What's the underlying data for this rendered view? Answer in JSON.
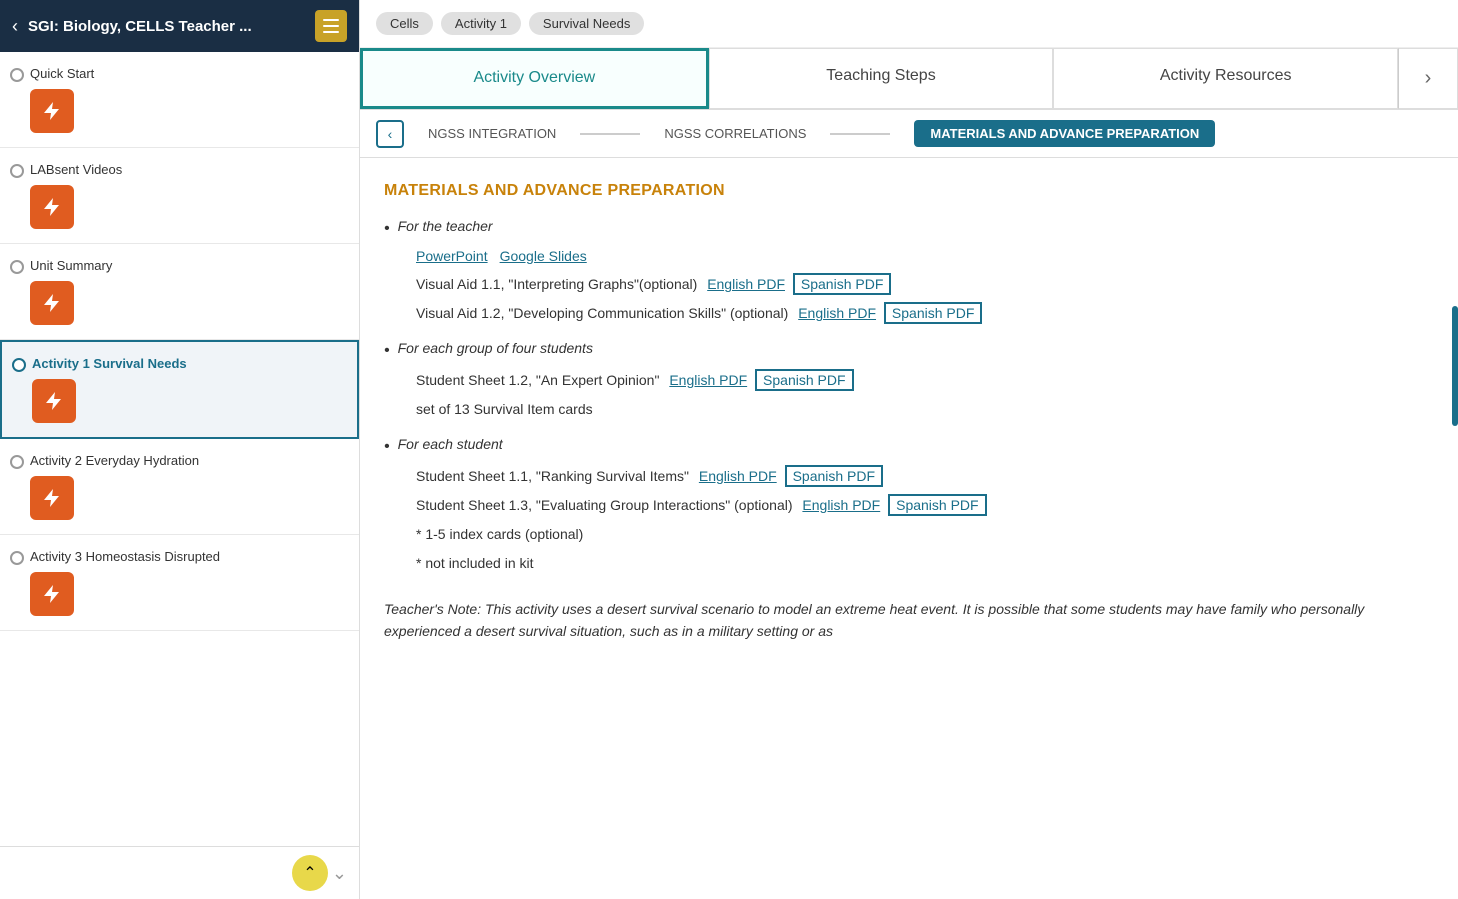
{
  "sidebar": {
    "header": {
      "title": "SGI: Biology, CELLS Teacher ...",
      "back_label": "‹",
      "menu_icon": "menu"
    },
    "items": [
      {
        "id": "quick-start",
        "label": "Quick Start",
        "active": false
      },
      {
        "id": "labsent-videos",
        "label": "LABsent Videos",
        "active": false
      },
      {
        "id": "unit-summary",
        "label": "Unit Summary",
        "active": false
      },
      {
        "id": "activity-1",
        "label": "Activity 1 Survival Needs",
        "active": true
      },
      {
        "id": "activity-2",
        "label": "Activity 2 Everyday Hydration",
        "active": false
      },
      {
        "id": "activity-3",
        "label": "Activity 3 Homeostasis Disrupted",
        "active": false
      }
    ],
    "scroll_up_label": "^"
  },
  "breadcrumb": {
    "items": [
      "Cells",
      "Activity 1",
      "Survival Needs"
    ]
  },
  "tabs": [
    {
      "id": "overview",
      "label": "Activity Overview",
      "active": true
    },
    {
      "id": "teaching",
      "label": "Teaching Steps",
      "active": false
    },
    {
      "id": "resources",
      "label": "Activity Resources",
      "active": false
    }
  ],
  "sub_nav": {
    "items": [
      {
        "id": "ngss-integration",
        "label": "NGSS INTEGRATION",
        "active": false
      },
      {
        "id": "ngss-correlations",
        "label": "NGSS CORRELATIONS",
        "active": false
      },
      {
        "id": "materials",
        "label": "MATERIALS AND ADVANCE PREPARATION",
        "active": true
      }
    ]
  },
  "content": {
    "title": "MATERIALS AND ADVANCE PREPARATION",
    "sections": [
      {
        "id": "for-teacher",
        "label": "For the teacher",
        "links_row": [
          {
            "text": "PowerPoint",
            "boxed": false
          },
          {
            "text": "Google Slides",
            "boxed": false
          }
        ],
        "items": [
          {
            "text": "Visual Aid 1.1, \"Interpreting Graphs\"(optional)",
            "links": [
              {
                "text": "English PDF",
                "boxed": false
              },
              {
                "text": "Spanish PDF",
                "boxed": true
              }
            ]
          },
          {
            "text": "Visual Aid 1.2, \"Developing Communication Skills\" (optional)",
            "links": [
              {
                "text": "English PDF",
                "boxed": false
              },
              {
                "text": "Spanish PDF",
                "boxed": true
              }
            ]
          }
        ]
      },
      {
        "id": "for-group",
        "label": "For each group of four students",
        "links_row": [],
        "items": [
          {
            "text": "Student Sheet 1.2, \"An Expert Opinion\"",
            "links": [
              {
                "text": "English PDF",
                "boxed": false
              },
              {
                "text": "Spanish PDF",
                "boxed": true
              }
            ]
          },
          {
            "text": "set of 13 Survival Item cards",
            "links": []
          }
        ]
      },
      {
        "id": "for-student",
        "label": "For each student",
        "links_row": [],
        "items": [
          {
            "text": "Student Sheet 1.1, \"Ranking Survival Items\"",
            "links": [
              {
                "text": "English PDF",
                "boxed": false
              },
              {
                "text": "Spanish PDF",
                "boxed": true
              }
            ]
          },
          {
            "text": "Student Sheet 1.3, \"Evaluating Group Interactions\" (optional)",
            "links": [
              {
                "text": "English PDF",
                "boxed": false
              },
              {
                "text": "Spanish PDF",
                "boxed": true
              }
            ]
          },
          {
            "text": "* 1-5 index cards (optional)",
            "links": []
          },
          {
            "text": "* not included in kit",
            "links": []
          }
        ]
      }
    ],
    "teacher_note": "Teacher's Note: This activity uses a desert survival scenario to model an extreme heat event. It is possible that some students may have family who personally experienced a desert survival situation, such as in a military setting or as"
  }
}
